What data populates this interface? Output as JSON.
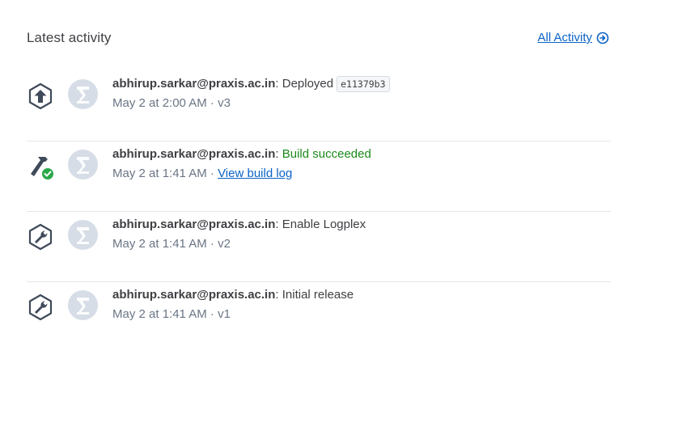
{
  "header": {
    "title": "Latest activity",
    "all_activity_label": "All Activity",
    "all_activity_icon": "arrow-circle-right-icon"
  },
  "colors": {
    "link": "#0b63c6",
    "success": "#1a8a1a",
    "icon": "#3f4a5a",
    "check_badge": "#2ba84a"
  },
  "activities": [
    {
      "icon": "deploy-upload-icon",
      "user": "abhirup.sarkar@praxis.ac.in",
      "action": "Deployed",
      "commit": "e11379b3",
      "time": "May 2 at 2:00 AM",
      "sep": "·",
      "version": "v3"
    },
    {
      "icon": "build-hammer-success-icon",
      "user": "abhirup.sarkar@praxis.ac.in",
      "action": "Build succeeded",
      "time": "May 2 at 1:41 AM",
      "sep": "·",
      "link_label": "View build log"
    },
    {
      "icon": "config-wrench-icon",
      "user": "abhirup.sarkar@praxis.ac.in",
      "action": "Enable Logplex",
      "time": "May 2 at 1:41 AM",
      "sep": "·",
      "version": "v2"
    },
    {
      "icon": "config-wrench-icon",
      "user": "abhirup.sarkar@praxis.ac.in",
      "action": "Initial release",
      "time": "May 2 at 1:41 AM",
      "sep": "·",
      "version": "v1"
    }
  ],
  "separator_colon": ":"
}
